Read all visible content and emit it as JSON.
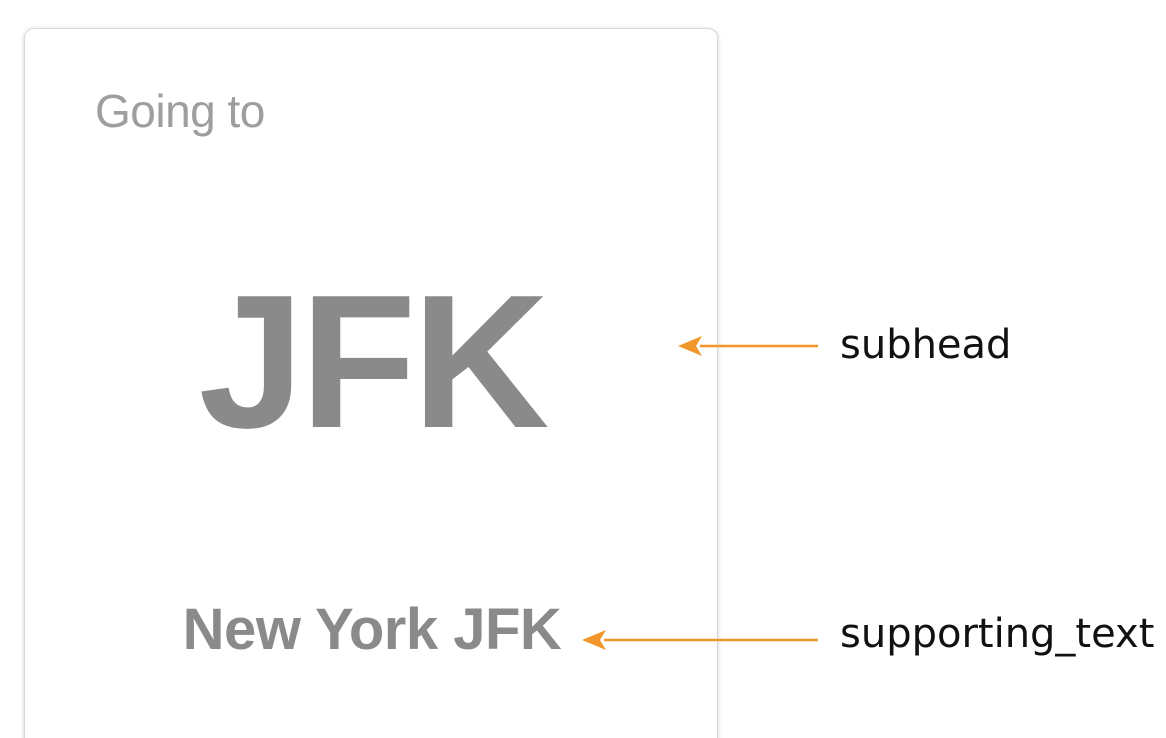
{
  "card": {
    "heading": "Going to",
    "subhead": "JFK",
    "supporting_text": "New York JFK"
  },
  "annotations": {
    "subhead_label": "subhead",
    "supporting_label": "supporting_text"
  },
  "colors": {
    "arrow": "#f0962a",
    "card_text": "#8a8a8a",
    "heading_text": "#9e9e9e",
    "card_border": "#d9d9d9"
  }
}
